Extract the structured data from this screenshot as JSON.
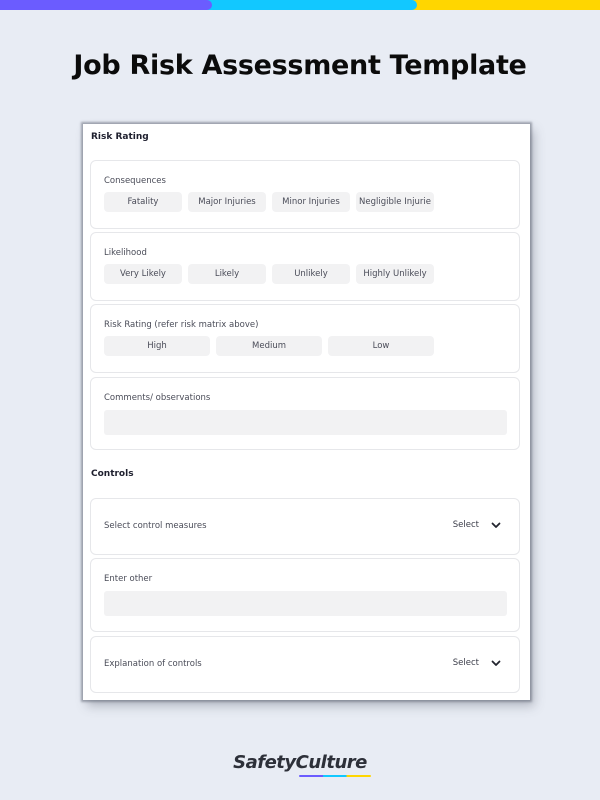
{
  "banner": {
    "colors": [
      "#6b5cff",
      "#12c8ff",
      "#ffd600"
    ]
  },
  "page_title": "Job Risk Assessment Template",
  "form": {
    "risk_rating_section": {
      "title": "Risk Rating",
      "consequences": {
        "label": "Consequences",
        "options": [
          "Fatality",
          "Major Injuries",
          "Minor Injuries",
          "Negligible Injurie"
        ]
      },
      "likelihood": {
        "label": "Likelihood",
        "options": [
          "Very Likely",
          "Likely",
          "Unlikely",
          "Highly Unlikely"
        ]
      },
      "risk_rating": {
        "label": "Risk Rating (refer risk matrix above)",
        "options": [
          "High",
          "Medium",
          "Low"
        ]
      },
      "comments": {
        "label": "Comments/ observations",
        "value": ""
      }
    },
    "controls_section": {
      "title": "Controls",
      "control_measures": {
        "label": "Select control measures",
        "select_label": "Select"
      },
      "enter_other": {
        "label": "Enter other",
        "value": ""
      },
      "explanation": {
        "label": "Explanation of controls",
        "select_label": "Select"
      }
    }
  },
  "brand": {
    "logo_text": "SafetyCulture"
  }
}
